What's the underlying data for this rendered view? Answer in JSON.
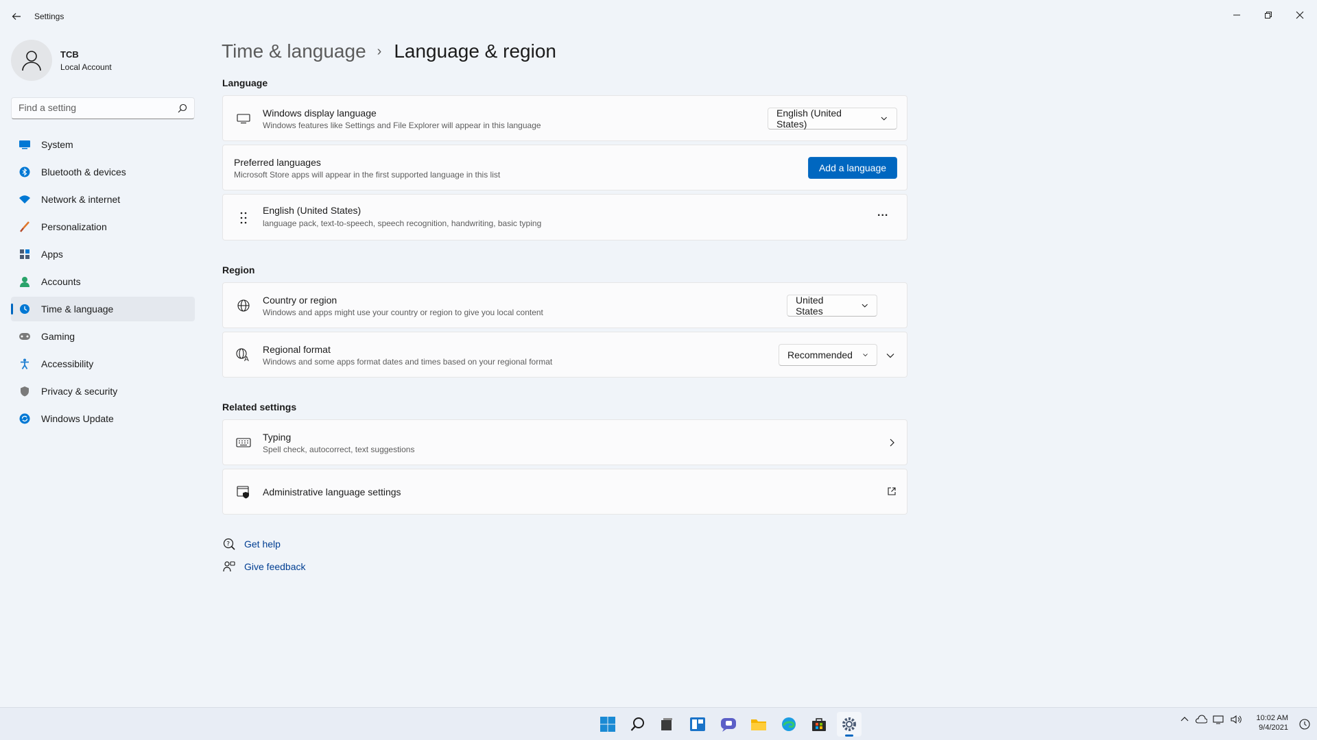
{
  "window": {
    "app_title": "Settings",
    "minimize_icon": "minimize-icon",
    "maximize_icon": "restore-icon",
    "close_icon": "close-icon"
  },
  "profile": {
    "name": "TCB",
    "account_type": "Local Account"
  },
  "search": {
    "placeholder": "Find a setting"
  },
  "sidebar": {
    "items": [
      {
        "label": "System",
        "icon": "system-icon",
        "color": "#0078d4"
      },
      {
        "label": "Bluetooth & devices",
        "icon": "bluetooth-icon",
        "color": "#0078d4"
      },
      {
        "label": "Network & internet",
        "icon": "wifi-icon",
        "color": "#0078d4"
      },
      {
        "label": "Personalization",
        "icon": "brush-icon",
        "color": "#e0772b"
      },
      {
        "label": "Apps",
        "icon": "apps-icon",
        "color": "#4a5a73"
      },
      {
        "label": "Accounts",
        "icon": "person-icon",
        "color": "#29a36a"
      },
      {
        "label": "Time & language",
        "icon": "globe-clock-icon",
        "color": "#0078d4"
      },
      {
        "label": "Gaming",
        "icon": "gamepad-icon",
        "color": "#6b6b6b"
      },
      {
        "label": "Accessibility",
        "icon": "accessibility-icon",
        "color": "#1f7fd1"
      },
      {
        "label": "Privacy & security",
        "icon": "shield-icon",
        "color": "#6b6b6b"
      },
      {
        "label": "Windows Update",
        "icon": "update-icon",
        "color": "#0078d4"
      }
    ],
    "active_index": 6
  },
  "breadcrumb": {
    "parent": "Time & language",
    "separator": "›",
    "current": "Language & region"
  },
  "language": {
    "section_title": "Language",
    "display_language": {
      "title": "Windows display language",
      "description": "Windows features like Settings and File Explorer will appear in this language",
      "value": "English (United States)"
    },
    "preferred": {
      "title": "Preferred languages",
      "description": "Microsoft Store apps will appear in the first supported language in this list",
      "button": "Add a language"
    },
    "installed": {
      "title": "English (United States)",
      "description": "language pack, text-to-speech, speech recognition, handwriting, basic typing",
      "more": "..."
    }
  },
  "region": {
    "section_title": "Region",
    "country": {
      "title": "Country or region",
      "description": "Windows and apps might use your country or region to give you local content",
      "value": "United States"
    },
    "format": {
      "title": "Regional format",
      "description": "Windows and some apps format dates and times based on your regional format",
      "value": "Recommended"
    }
  },
  "related": {
    "section_title": "Related settings",
    "typing": {
      "title": "Typing",
      "description": "Spell check, autocorrect, text suggestions"
    },
    "admin": {
      "title": "Administrative language settings"
    }
  },
  "help": {
    "get_help": "Get help",
    "give_feedback": "Give feedback"
  },
  "taskbar": {
    "apps": [
      "start-icon",
      "search-icon",
      "task-view-icon",
      "widgets-icon",
      "chat-icon",
      "file-explorer-icon",
      "edge-icon",
      "store-icon",
      "settings-icon"
    ],
    "time": "10:02 AM",
    "date": "9/4/2021",
    "accent": "#0067c0"
  }
}
